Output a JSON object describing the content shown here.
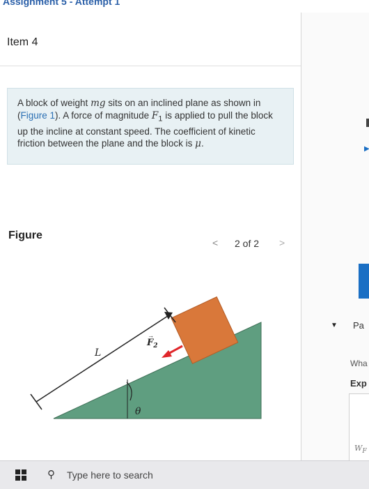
{
  "header": {
    "assignment_link": "Assignment 5 - Attempt 1"
  },
  "item": {
    "title": "Item 4"
  },
  "problem": {
    "t1": "A block of weight ",
    "v_mg": "mg",
    "t2": " sits on an inclined plane as shown in (",
    "figure_link": "Figure 1",
    "t3": "). A force of magnitude ",
    "v_F1": "F",
    "v_F1_sub": "1",
    "t4": " is applied to pull the block up the incline at constant speed. The coefficient of kinetic friction between the plane and the block is ",
    "v_mu": "μ",
    "t5": "."
  },
  "figure": {
    "title": "Figure",
    "pager_prev": "<",
    "pager_count": "2 of 2",
    "pager_next": ">",
    "label_L": "L",
    "label_F": "F",
    "label_F_sub": "2",
    "label_theta": "θ",
    "colors": {
      "incline": "#5f9e80",
      "block": "#d9783a",
      "arrow": "#e0262a"
    }
  },
  "right_panel": {
    "caret": "▼",
    "part_label": "Pa",
    "what_label": "Wha",
    "exp_label": "Exp",
    "wf_label": "W",
    "wf_sub": "F"
  },
  "taskbar": {
    "search_placeholder": "Type here to search",
    "search_icon": "search-icon",
    "start_icon": "windows-icon"
  }
}
